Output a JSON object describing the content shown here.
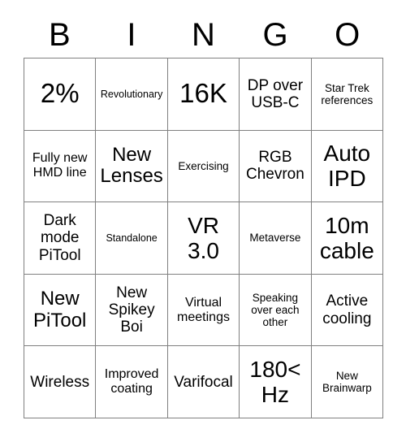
{
  "card": {
    "header": {
      "letters": [
        "B",
        "I",
        "N",
        "G",
        "O"
      ]
    },
    "grid": {
      "rows": [
        {
          "cells": [
            {
              "text": "2%",
              "size": "xxl"
            },
            {
              "text": "Revolutionary",
              "size": "xxs"
            },
            {
              "text": "16K",
              "size": "xxl"
            },
            {
              "text": "DP over USB-C",
              "size": "md"
            },
            {
              "text": "Star Trek references",
              "size": "xs"
            }
          ]
        },
        {
          "cells": [
            {
              "text": "Fully new HMD line",
              "size": "sm"
            },
            {
              "text": "New Lenses",
              "size": "lg"
            },
            {
              "text": "Exercising",
              "size": "xs"
            },
            {
              "text": "RGB Chevron",
              "size": "md"
            },
            {
              "text": "Auto IPD",
              "size": "xl"
            }
          ]
        },
        {
          "cells": [
            {
              "text": "Dark mode PiTool",
              "size": "md"
            },
            {
              "text": "Standalone",
              "size": "xxs"
            },
            {
              "text": "VR 3.0",
              "size": "xl"
            },
            {
              "text": "Metaverse",
              "size": "xs"
            },
            {
              "text": "10m cable",
              "size": "xl"
            }
          ]
        },
        {
          "cells": [
            {
              "text": "New PiTool",
              "size": "lg"
            },
            {
              "text": "New Spikey Boi",
              "size": "md"
            },
            {
              "text": "Virtual meetings",
              "size": "sm"
            },
            {
              "text": "Speaking over each other",
              "size": "xs"
            },
            {
              "text": "Active cooling",
              "size": "md"
            }
          ]
        },
        {
          "cells": [
            {
              "text": "Wireless",
              "size": "md"
            },
            {
              "text": "Improved coating",
              "size": "sm"
            },
            {
              "text": "Varifocal",
              "size": "md"
            },
            {
              "text": "180< Hz",
              "size": "xl"
            },
            {
              "text": "New Brainwarp",
              "size": "xs"
            }
          ]
        }
      ]
    },
    "colors": {
      "border": "#808080",
      "cell_background": "#ffffff",
      "text": "#000000"
    }
  }
}
